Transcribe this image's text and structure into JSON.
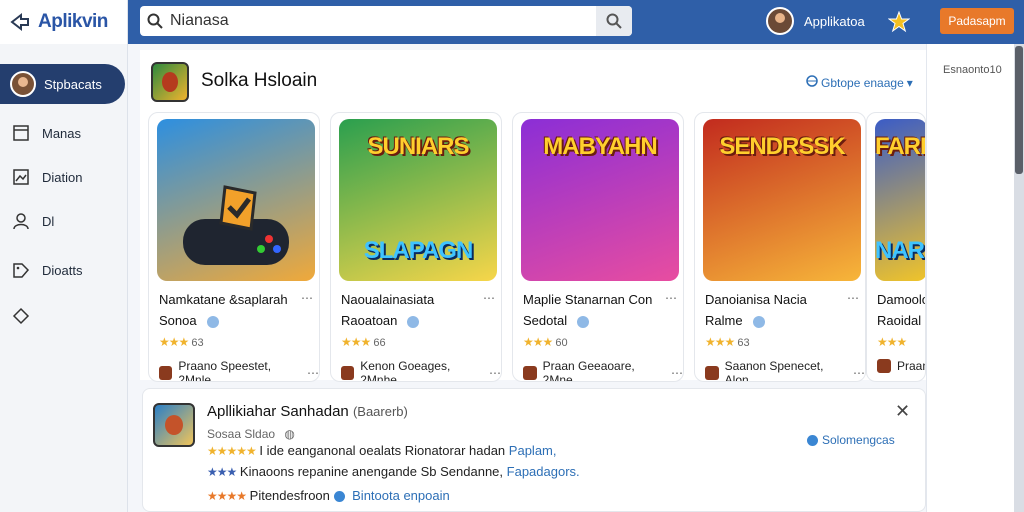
{
  "app": {
    "name": "Aplikvin"
  },
  "search": {
    "value": "Nianasa",
    "placeholder": ""
  },
  "topbar": {
    "user_name": "Applikatoa",
    "action_label": "Padasapm"
  },
  "sidebar": {
    "items": [
      {
        "label": "Stpbacats",
        "icon": "user-avatar"
      },
      {
        "label": "Manas",
        "icon": "book-icon"
      },
      {
        "label": "Diation",
        "icon": "image-icon"
      },
      {
        "label": "Dl",
        "icon": "person-icon"
      },
      {
        "label": "Dioatts",
        "icon": "tag-icon"
      },
      {
        "label": "",
        "icon": "diamond-icon"
      }
    ]
  },
  "section": {
    "title": "Solka Hsloain",
    "link": "Gbtope enaage"
  },
  "right_panel": {
    "label": "Esnaonto10"
  },
  "cards": [
    {
      "art_title": "",
      "line1": "Namkatane &saplarah",
      "line2": "Sonoa",
      "rating": "63",
      "meta": "Praano Speestet, 2Mnle",
      "colors": [
        "#2d8fe0",
        "#f0a93a"
      ]
    },
    {
      "art_title": "SUNIARS",
      "art_sub": "SLAPAGN",
      "line1": "Naoualainasiata",
      "line2": "Raoatoan",
      "rating": "66",
      "meta": "Kenon Goeages, 2Mnhe",
      "colors": [
        "#2a9f4e",
        "#f7d64a"
      ]
    },
    {
      "art_title": "MABYAHN",
      "line1": "Maplie Stanarnan Con",
      "line2": "Sedotal",
      "rating": "60",
      "meta": "Praan Geeaoare, 2Mne",
      "colors": [
        "#8b2ed6",
        "#e84da0"
      ]
    },
    {
      "art_title": "SENDRSSK",
      "line1": "Danoianisa Nacia",
      "line2": "Ralme",
      "rating": "63",
      "meta": "Saanon Spenecet, Alon",
      "colors": [
        "#c22b1e",
        "#f7b63a"
      ]
    },
    {
      "art_title": "FAREB",
      "art_sub": "NARB",
      "line1": "Damoolo",
      "line2": "Raoidal",
      "rating": "",
      "meta": "Praan",
      "colors": [
        "#3b5cc6",
        "#f0c42a"
      ]
    }
  ],
  "detail": {
    "title": "Apllikiahar Sanhadan",
    "title_sub": "(Baarerb)",
    "sub": "Sosaa Sldao",
    "action": "Solomengcas",
    "line1_text": "I ide eanganonal oealats Rionatorar hadan",
    "line1_link": "Paplam,",
    "line2_text": "Kinaoons repanine anengande Sb Sendanne,",
    "line2_link": "Fapadagors.",
    "line3_text": "Pitendesfroon",
    "line3_link": "Bintoota enpoain"
  }
}
